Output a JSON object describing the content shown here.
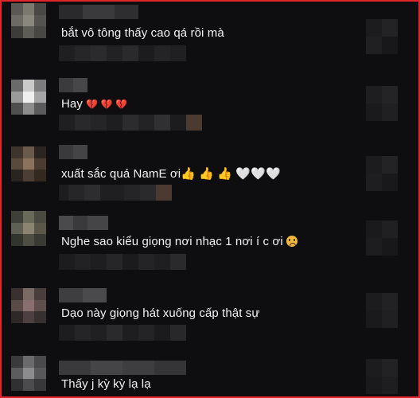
{
  "comments": [
    {
      "text": "bắt vô tông thấy cao qá rồi mà",
      "suffix": ""
    },
    {
      "text": "Hay ",
      "suffix": "💔 💔 💔"
    },
    {
      "text": "xuất sắc quá NamE ơi",
      "suffix": "👍 👍 👍 🤍🤍🤍"
    },
    {
      "text": "Nghe sao kiểu giọng nơi nhạc 1 nơi í c ơi ",
      "suffix": "sad-face"
    },
    {
      "text": "Dạo này giọng hát xuống cấp thật sự",
      "suffix": ""
    },
    {
      "text": "Thấy j kỳ kỳ lạ lạ",
      "suffix": ""
    }
  ],
  "colors": {
    "background": "#0e0e10",
    "border": "#e0242a",
    "text": "#f2f2f2"
  },
  "icons": [
    "broken-heart-icon",
    "thumbs-up-icon",
    "white-heart-icon",
    "sad-face-icon"
  ]
}
